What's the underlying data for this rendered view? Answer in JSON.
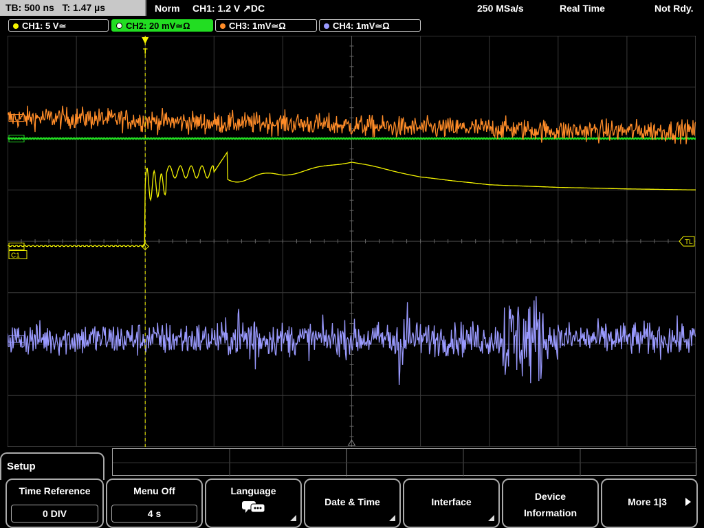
{
  "top": {
    "timebase": "TB: 500 ns",
    "trigger_time": "T: 1.47 µs",
    "mode": "Norm",
    "trigger_info": "CH1: 1.2 V ↗DC",
    "sample_rate": "250 MSa/s",
    "acq_mode": "Real Time",
    "status": "Not Rdy."
  },
  "channels": [
    {
      "label": "CH1: 5 V≃",
      "color": "#f5f500",
      "active": false
    },
    {
      "label": "CH2: 20 mV≃Ω",
      "color": "#22dd22",
      "active": true
    },
    {
      "label": "CH3: 1mV≃Ω",
      "color": "#ff8c28",
      "active": false
    },
    {
      "label": "CH4: 1mV≃Ω",
      "color": "#9a9aff",
      "active": false
    }
  ],
  "markers": {
    "c1": "C1",
    "tl": "TL",
    "trigger": "T"
  },
  "menu": {
    "title": "Setup",
    "buttons": [
      {
        "label": "Time Reference",
        "value": "0 DIV"
      },
      {
        "label": "Menu Off",
        "value": "4 s"
      },
      {
        "label": "Language",
        "icon": "speech-bubbles-icon"
      },
      {
        "label": "Date & Time"
      },
      {
        "label": "Interface"
      },
      {
        "label": "Device Information"
      },
      {
        "label": "More 1|3"
      }
    ]
  },
  "chart_data": {
    "type": "line",
    "title": "",
    "xlabel": "",
    "ylabel": "",
    "grid": true,
    "divisions": {
      "x": 10,
      "y": 8
    },
    "trigger_position_div": -3,
    "series": [
      {
        "name": "CH1",
        "color": "#f5f500",
        "description_values_div": [
          -0.1,
          -0.1,
          1.3,
          1.2,
          1.3,
          1.55,
          1.25,
          1.1,
          1.05,
          1.02,
          1.0
        ]
      },
      {
        "name": "CH2",
        "color": "#22dd22",
        "description_values_div": [
          2.0,
          2.0,
          2.0,
          2.0,
          2.0,
          2.0,
          2.0,
          2.0,
          2.0,
          2.0,
          2.0
        ]
      },
      {
        "name": "CH3",
        "color": "#ff8c28",
        "description_values_div": [
          2.4,
          2.4,
          2.35,
          2.3,
          2.3,
          2.25,
          2.2,
          2.2,
          2.15,
          2.15,
          2.15
        ]
      },
      {
        "name": "CH4",
        "color": "#9a9aff",
        "description_values_div": [
          -1.9,
          -1.9,
          -1.9,
          -1.9,
          -1.9,
          -1.9,
          -1.9,
          -1.9,
          -1.9,
          -1.9,
          -1.9
        ]
      }
    ]
  }
}
